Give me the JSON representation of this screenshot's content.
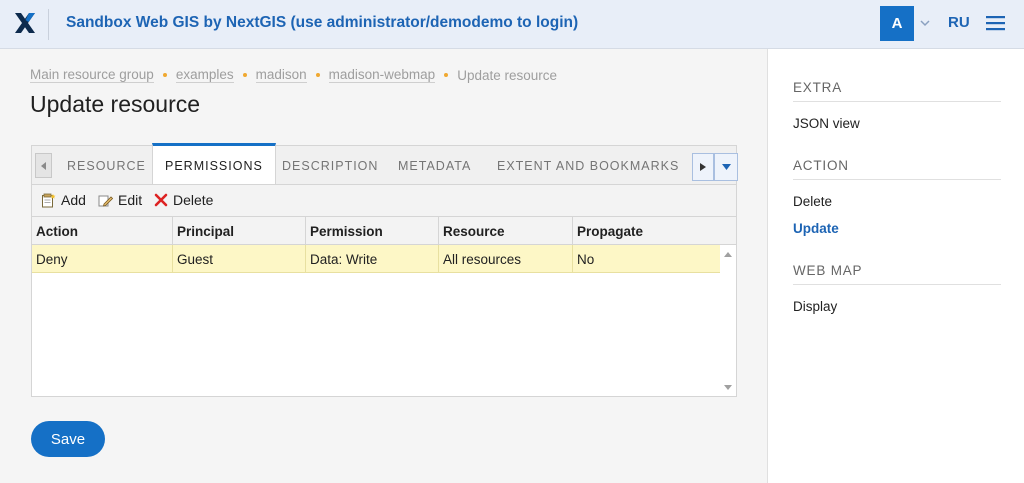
{
  "header": {
    "site_title": "Sandbox Web GIS by NextGIS (use administrator/demodemo to login)",
    "avatar_letter": "A",
    "language": "RU",
    "accent_color": "#1570c6"
  },
  "breadcrumb": {
    "items": [
      "Main resource group",
      "examples",
      "madison",
      "madison-webmap"
    ],
    "current": "Update resource"
  },
  "page": {
    "title": "Update resource"
  },
  "tabs": {
    "items": [
      "RESOURCE",
      "PERMISSIONS",
      "DESCRIPTION",
      "METADATA",
      "EXTENT AND BOOKMARKS"
    ],
    "active": "PERMISSIONS"
  },
  "toolbar": {
    "add_label": "Add",
    "edit_label": "Edit",
    "delete_label": "Delete"
  },
  "grid": {
    "columns": [
      "Action",
      "Principal",
      "Permission",
      "Resource",
      "Propagate"
    ],
    "rows": [
      [
        "Deny",
        "Guest",
        "Data: Write",
        "All resources",
        "No"
      ]
    ]
  },
  "sidebar": {
    "sections": [
      {
        "title": "EXTRA",
        "items": [
          {
            "label": "JSON view"
          }
        ]
      },
      {
        "title": "ACTION",
        "items": [
          {
            "label": "Delete"
          },
          {
            "label": "Update"
          }
        ]
      },
      {
        "title": "WEB MAP",
        "items": [
          {
            "label": "Display"
          }
        ]
      }
    ],
    "active_item": "Update"
  },
  "save_label": "Save"
}
